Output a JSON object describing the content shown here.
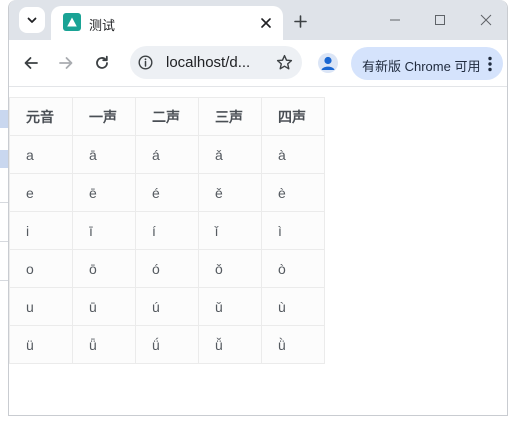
{
  "browser": {
    "tab": {
      "title": "测试",
      "favicon": "triangle-favicon-icon",
      "close_icon": "close-icon"
    },
    "new_tab_icon": "plus-icon",
    "window_controls": [
      "minimize-icon",
      "maximize-icon",
      "close-icon"
    ],
    "toolbar": {
      "back_icon": "back-arrow-icon",
      "forward_icon": "forward-arrow-icon",
      "reload_icon": "reload-icon",
      "url": "localhost/d...",
      "info_icon": "info-icon",
      "bookmark_icon": "star-icon",
      "profile_icon": "person-icon",
      "update_label": "有新版 Chrome 可用",
      "menu_icon": "kebab-menu-icon"
    }
  },
  "table": {
    "headers": [
      "元音",
      "一声",
      "二声",
      "三声",
      "四声"
    ],
    "rows": [
      [
        "a",
        "ā",
        "á",
        "ǎ",
        "à"
      ],
      [
        "e",
        "ē",
        "é",
        "ě",
        "è"
      ],
      [
        "i",
        "ī",
        "í",
        "ǐ",
        "ì"
      ],
      [
        "o",
        "ō",
        "ó",
        "ǒ",
        "ò"
      ],
      [
        "u",
        "ū",
        "ú",
        "ǔ",
        "ù"
      ],
      [
        "ü",
        "ǖ",
        "ǘ",
        "ǚ",
        "ǜ"
      ]
    ]
  },
  "colors": {
    "titlebar": "#dfe3e9",
    "accent_chip": "#d5e3fc",
    "favicon": "#1aa395"
  }
}
